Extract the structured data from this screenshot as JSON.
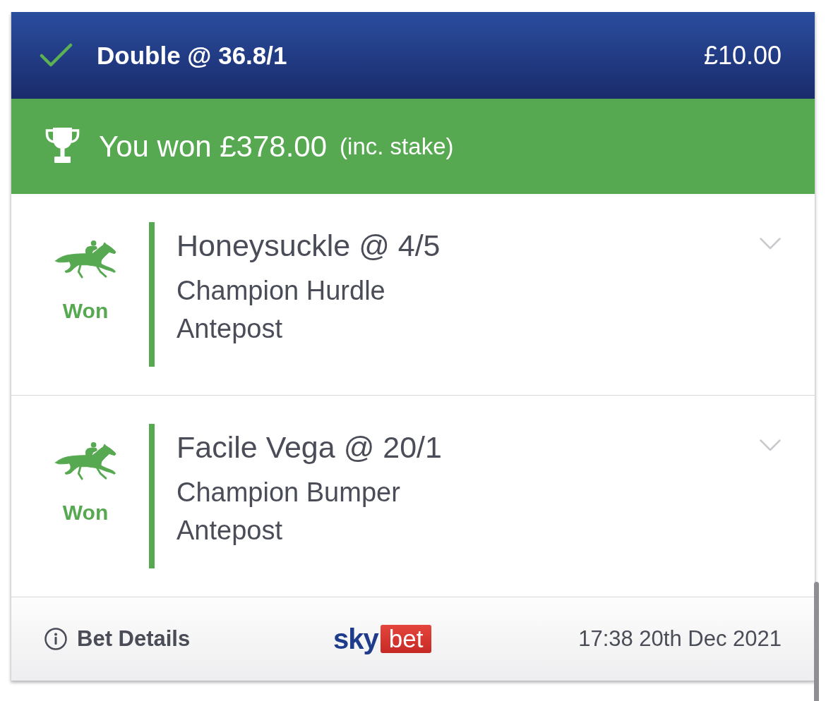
{
  "header": {
    "title": "Double @ 36.8/1",
    "stake": "£10.00"
  },
  "win_banner": {
    "amount": "You won £378.00",
    "note": "(inc. stake)"
  },
  "selections": [
    {
      "name": "Honeysuckle @ 4/5",
      "event": "Champion Hurdle",
      "market": "Antepost",
      "result": "Won",
      "expanded": false
    },
    {
      "name": "Facile Vega @ 20/1",
      "event": "Champion Bumper",
      "market": "Antepost",
      "result": "Won",
      "expanded": false
    }
  ],
  "footer": {
    "details_link": "Bet Details",
    "logo": {
      "word_1": "sky",
      "word_2": "bet"
    },
    "placed_at": "17:38 20th Dec 2021"
  }
}
